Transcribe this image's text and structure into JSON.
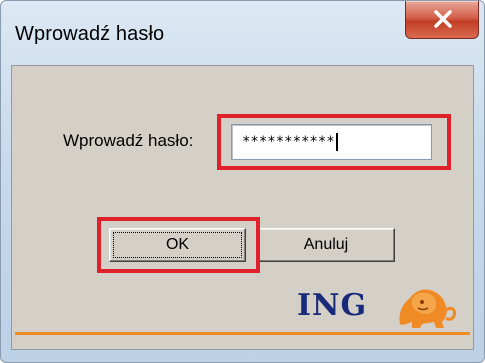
{
  "window": {
    "title": "Wprowadź hasło"
  },
  "form": {
    "password_label": "Wprowadź hasło:",
    "password_value": "***********"
  },
  "buttons": {
    "ok_label": "OK",
    "cancel_label": "Anuluj"
  },
  "logo": {
    "text": "ING",
    "icon": "lion-icon"
  },
  "colors": {
    "highlight": "#e0202a",
    "accent_line": "#f08a24",
    "ing_blue": "#1a2a7a",
    "ing_orange": "#f08a24"
  }
}
